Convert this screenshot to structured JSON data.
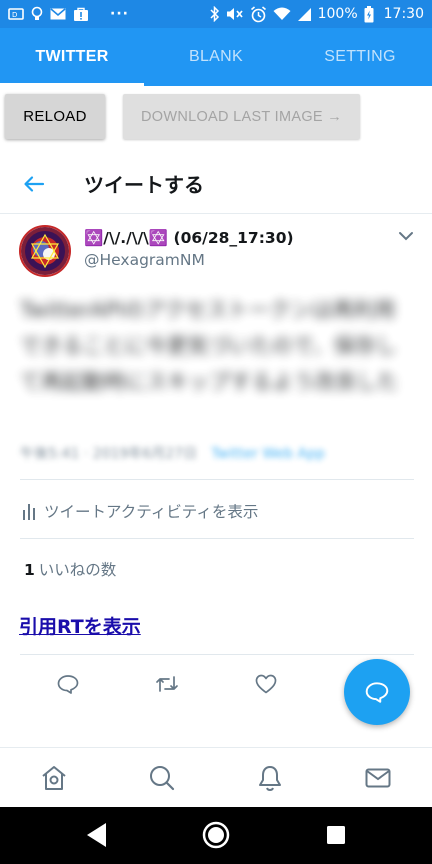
{
  "status_bar": {
    "battery": "100%",
    "time": "17:30",
    "dots": "···",
    "icons": [
      "tv-icon",
      "lightbulb-icon",
      "gmail-icon",
      "bag-icon",
      "more-icon",
      "bluetooth-icon",
      "mute-icon",
      "alarm-icon",
      "wifi-icon",
      "signal-icon",
      "battery-icon"
    ]
  },
  "tabs": [
    {
      "label": "TWITTER",
      "active": true
    },
    {
      "label": "BLANK",
      "active": false
    },
    {
      "label": "SETTING",
      "active": false
    }
  ],
  "buttons": {
    "reload": "RELOAD",
    "download": "DOWNLOAD LAST IMAGE →"
  },
  "web_header": {
    "title": "ツイートする"
  },
  "tweet": {
    "name": "✡️/\\/./\\/\\✡️ (06/28_17:30)",
    "handle": "@HexagramNM",
    "text": "TwitterAPIのアクセストークンは再利用できることに今更気づいたので、保存して再起動時にスキップするよう改良した",
    "meta": "午後5:41 · 2019年6月27日",
    "via": "Twitter Web App",
    "activity": "ツイートアクティビティを表示",
    "likes_count": "1",
    "likes_label": "いいねの数",
    "quote_link": "引用RTを表示"
  },
  "colors": {
    "accent": "#2196f3",
    "status_bar": "#1e88e5",
    "twitter_blue": "#1da1f2",
    "link": "#1a0dab"
  }
}
